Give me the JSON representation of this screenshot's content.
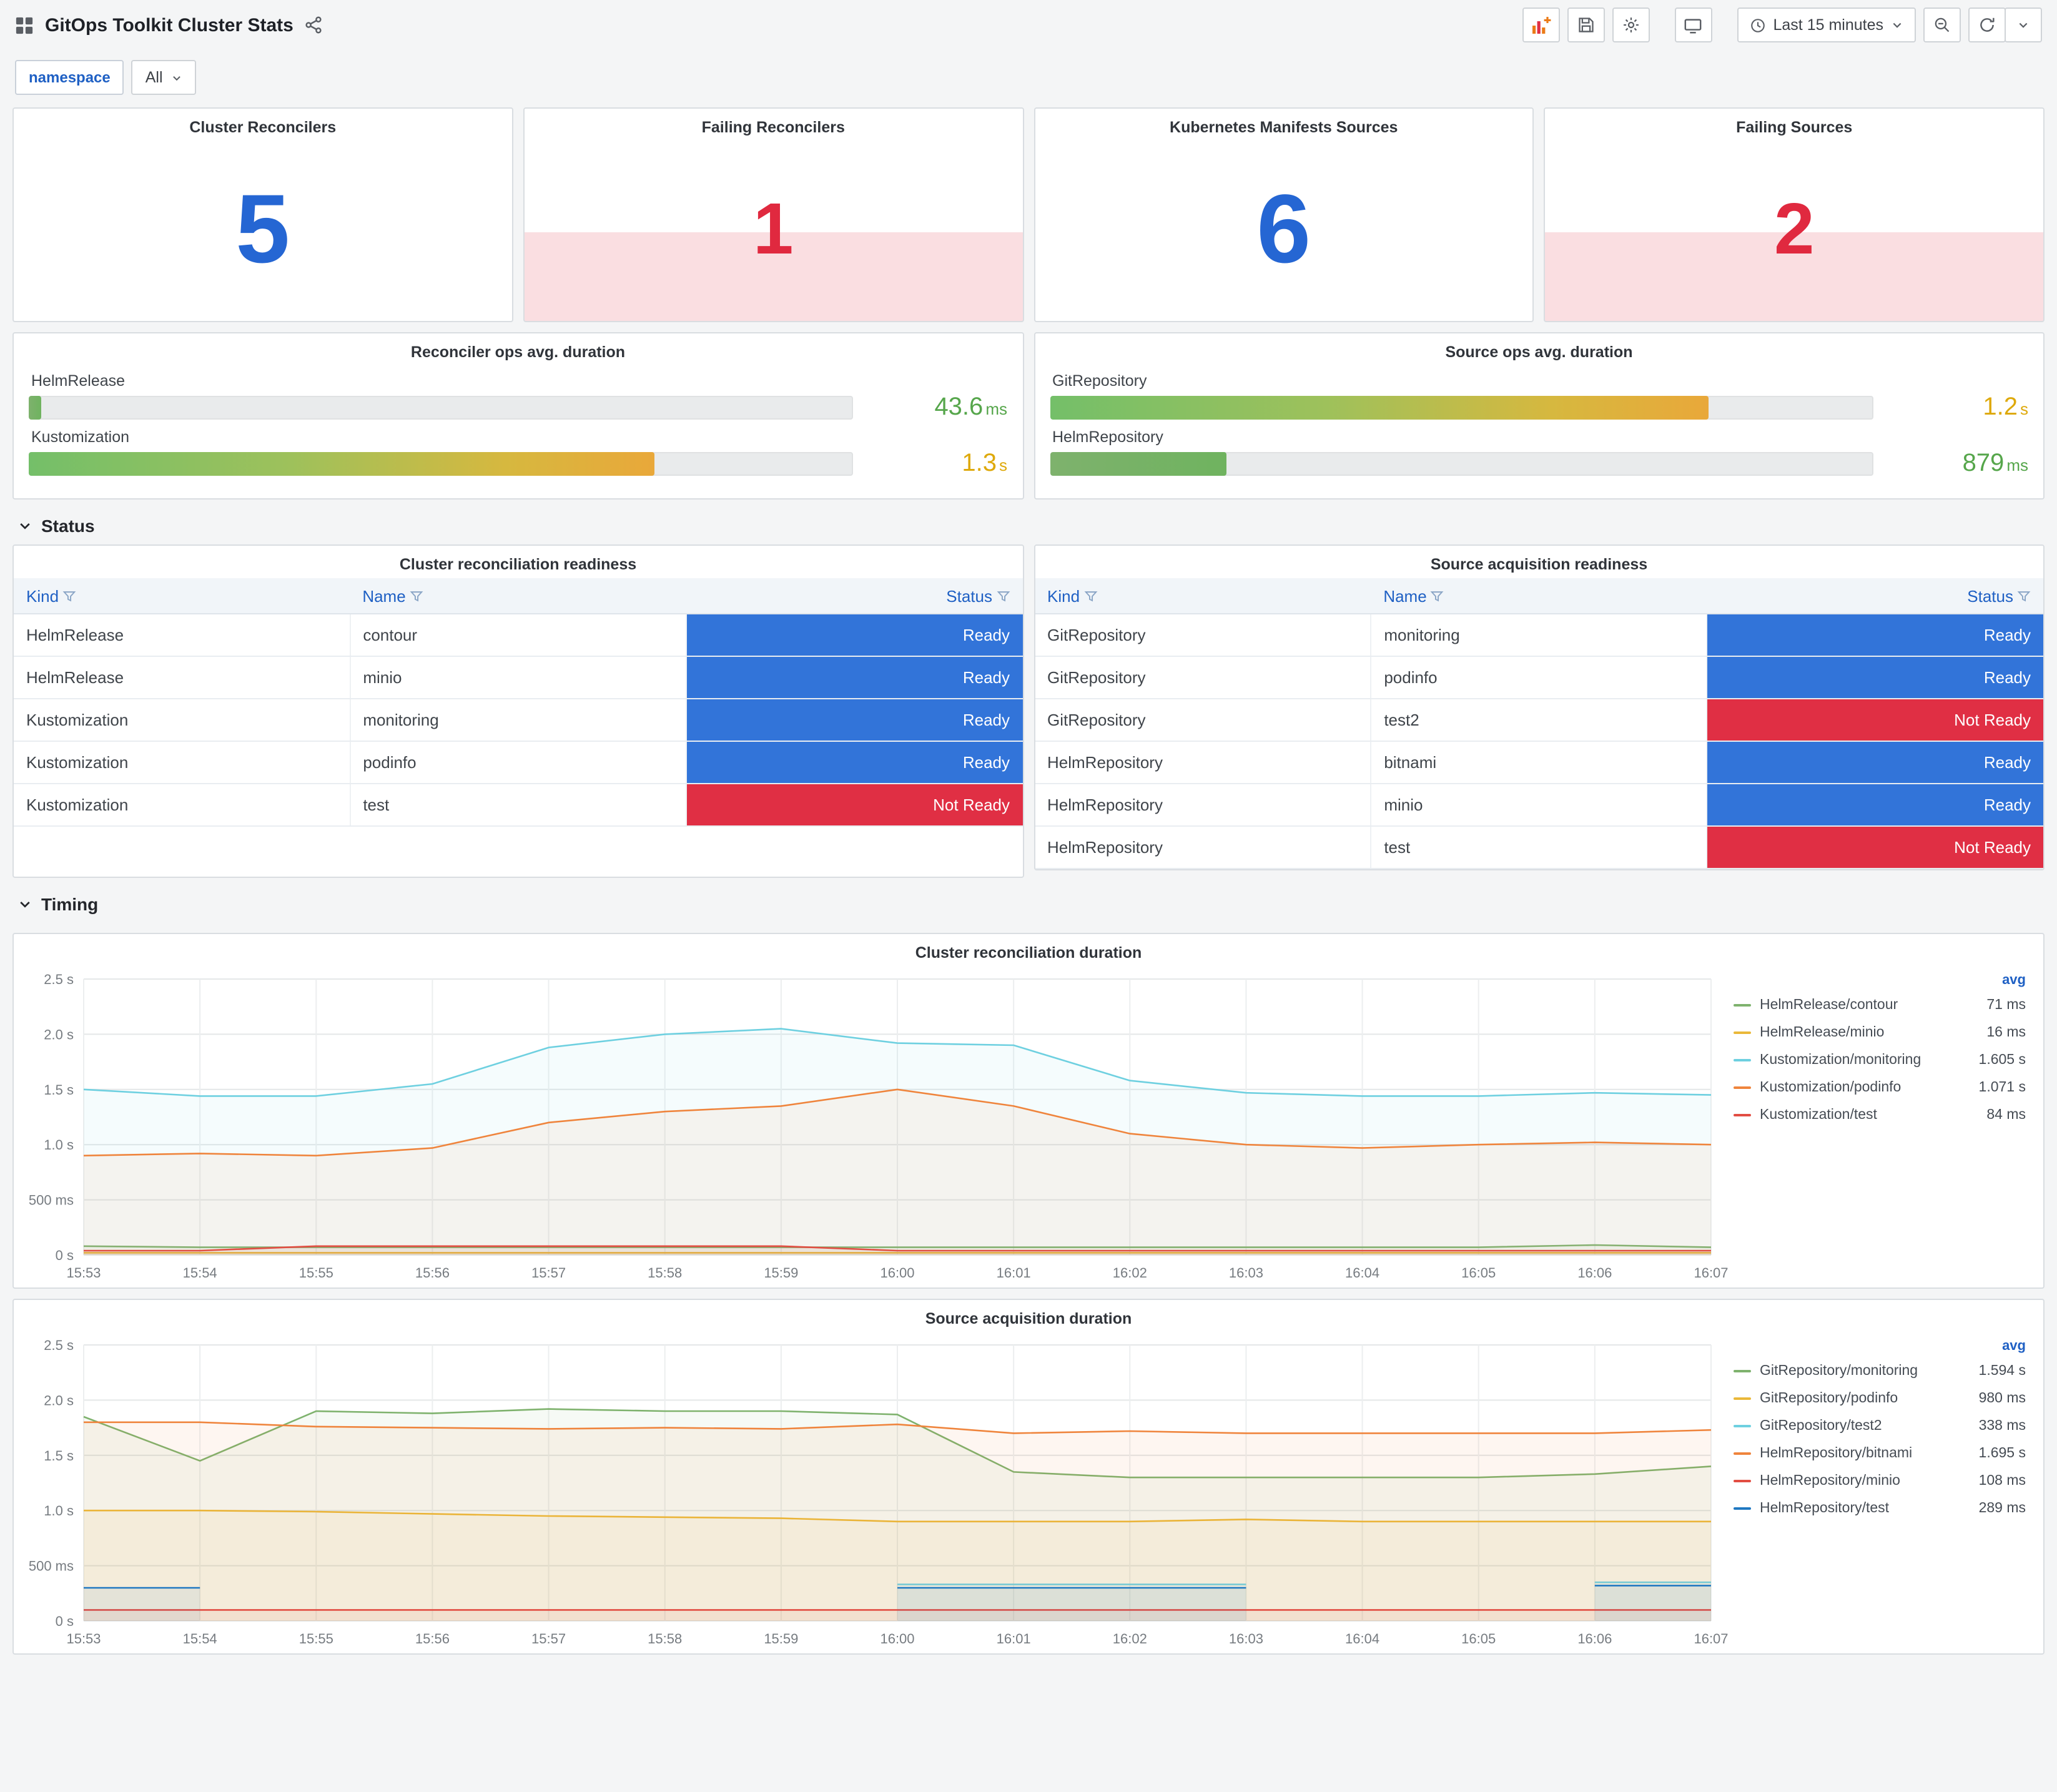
{
  "header": {
    "title": "GitOps Toolkit Cluster Stats",
    "time_range": "Last 15 minutes"
  },
  "variables": {
    "label": "namespace",
    "value": "All"
  },
  "colors": {
    "stat_blue": "#2566d3",
    "alert_red": "#e0293f",
    "ready_bg": "#3274D9",
    "not_ready_bg": "#E02F44",
    "accent_blue": "#1f60c4"
  },
  "stats": [
    {
      "title": "Cluster Reconcilers",
      "value": "5",
      "state": "ok"
    },
    {
      "title": "Failing Reconcilers",
      "value": "1",
      "state": "alert"
    },
    {
      "title": "Kubernetes Manifests Sources",
      "value": "6",
      "state": "ok"
    },
    {
      "title": "Failing Sources",
      "value": "2",
      "state": "alert"
    }
  ],
  "gauges": [
    {
      "title": "Reconciler ops avg. duration",
      "rows": [
        {
          "label": "HelmRelease",
          "value": "43.6",
          "unit": "ms",
          "percent": "1.5%",
          "value_color": "#56A64B"
        },
        {
          "label": "Kustomization",
          "value": "1.3",
          "unit": "s",
          "percent": "76%",
          "value_color": "#DEA90B"
        }
      ]
    },
    {
      "title": "Source ops avg. duration",
      "rows": [
        {
          "label": "GitRepository",
          "value": "1.2",
          "unit": "s",
          "percent": "80%",
          "value_color": "#DEA90B"
        },
        {
          "label": "HelmRepository",
          "value": "879",
          "unit": "ms",
          "percent": "21.5%",
          "value_color": "#56A64B"
        }
      ]
    }
  ],
  "sections": {
    "status": "Status",
    "timing": "Timing"
  },
  "tables": [
    {
      "title": "Cluster reconciliation readiness",
      "columns": [
        "Kind",
        "Name",
        "Status"
      ],
      "rows": [
        {
          "kind": "HelmRelease",
          "name": "contour",
          "status": "Ready"
        },
        {
          "kind": "HelmRelease",
          "name": "minio",
          "status": "Ready"
        },
        {
          "kind": "Kustomization",
          "name": "monitoring",
          "status": "Ready"
        },
        {
          "kind": "Kustomization",
          "name": "podinfo",
          "status": "Ready"
        },
        {
          "kind": "Kustomization",
          "name": "test",
          "status": "Not Ready"
        }
      ]
    },
    {
      "title": "Source acquisition readiness",
      "columns": [
        "Kind",
        "Name",
        "Status"
      ],
      "rows": [
        {
          "kind": "GitRepository",
          "name": "monitoring",
          "status": "Ready"
        },
        {
          "kind": "GitRepository",
          "name": "podinfo",
          "status": "Ready"
        },
        {
          "kind": "GitRepository",
          "name": "test2",
          "status": "Not Ready"
        },
        {
          "kind": "HelmRepository",
          "name": "bitnami",
          "status": "Ready"
        },
        {
          "kind": "HelmRepository",
          "name": "minio",
          "status": "Ready"
        },
        {
          "kind": "HelmRepository",
          "name": "test",
          "status": "Not Ready"
        }
      ]
    }
  ],
  "chart_data": [
    {
      "type": "line",
      "title": "Cluster reconciliation duration",
      "x": [
        "15:53",
        "15:54",
        "15:55",
        "15:56",
        "15:57",
        "15:58",
        "15:59",
        "16:00",
        "16:01",
        "16:02",
        "16:03",
        "16:04",
        "16:05",
        "16:06",
        "16:07"
      ],
      "ylim": [
        0,
        2.5
      ],
      "yticks": [
        0,
        0.5,
        1.0,
        1.5,
        2.0,
        2.5
      ],
      "ytick_labels": [
        "0 s",
        "500 ms",
        "1.0 s",
        "1.5 s",
        "2.0 s",
        "2.5 s"
      ],
      "grid": true,
      "legend_position": "right",
      "legend_header": "avg",
      "series": [
        {
          "name": "HelmRelease/contour",
          "color": "#7EB26D",
          "avg": "71 ms",
          "values": [
            0.08,
            0.07,
            0.07,
            0.07,
            0.07,
            0.07,
            0.07,
            0.07,
            0.07,
            0.07,
            0.07,
            0.07,
            0.07,
            0.09,
            0.07
          ]
        },
        {
          "name": "HelmRelease/minio",
          "color": "#EAB839",
          "avg": "16 ms",
          "values": [
            0.02,
            0.02,
            0.02,
            0.02,
            0.02,
            0.02,
            0.02,
            0.02,
            0.02,
            0.02,
            0.02,
            0.02,
            0.02,
            0.02,
            0.02
          ]
        },
        {
          "name": "Kustomization/monitoring",
          "color": "#6ED0E0",
          "avg": "1.605 s",
          "values": [
            1.5,
            1.44,
            1.44,
            1.55,
            1.88,
            2.0,
            2.05,
            1.92,
            1.9,
            1.58,
            1.47,
            1.44,
            1.44,
            1.47,
            1.45
          ]
        },
        {
          "name": "Kustomization/podinfo",
          "color": "#EF843C",
          "avg": "1.071 s",
          "values": [
            0.9,
            0.92,
            0.9,
            0.97,
            1.2,
            1.3,
            1.35,
            1.5,
            1.35,
            1.1,
            1.0,
            0.97,
            1.0,
            1.02,
            1.0
          ]
        },
        {
          "name": "Kustomization/test",
          "color": "#E24D42",
          "avg": "84 ms",
          "values": [
            0.04,
            0.04,
            0.08,
            0.08,
            0.08,
            0.08,
            0.08,
            0.04,
            0.04,
            0.04,
            0.04,
            0.04,
            0.04,
            0.04,
            0.04
          ]
        }
      ]
    },
    {
      "type": "line",
      "title": "Source acquisition duration",
      "x": [
        "15:53",
        "15:54",
        "15:55",
        "15:56",
        "15:57",
        "15:58",
        "15:59",
        "16:00",
        "16:01",
        "16:02",
        "16:03",
        "16:04",
        "16:05",
        "16:06",
        "16:07"
      ],
      "ylim": [
        0,
        2.5
      ],
      "yticks": [
        0,
        0.5,
        1.0,
        1.5,
        2.0,
        2.5
      ],
      "ytick_labels": [
        "0 s",
        "500 ms",
        "1.0 s",
        "1.5 s",
        "2.0 s",
        "2.5 s"
      ],
      "grid": true,
      "legend_position": "right",
      "legend_header": "avg",
      "series": [
        {
          "name": "GitRepository/monitoring",
          "color": "#7EB26D",
          "avg": "1.594 s",
          "values": [
            1.85,
            1.45,
            1.9,
            1.88,
            1.92,
            1.9,
            1.9,
            1.87,
            1.35,
            1.3,
            1.3,
            1.3,
            1.3,
            1.33,
            1.4
          ]
        },
        {
          "name": "GitRepository/podinfo",
          "color": "#EAB839",
          "avg": "980 ms",
          "values": [
            1.0,
            1.0,
            0.99,
            0.97,
            0.95,
            0.94,
            0.93,
            0.9,
            0.9,
            0.9,
            0.92,
            0.9,
            0.9,
            0.9,
            0.9
          ]
        },
        {
          "name": "GitRepository/test2",
          "color": "#6ED0E0",
          "avg": "338 ms",
          "values": [
            null,
            null,
            null,
            null,
            null,
            null,
            null,
            0.33,
            0.33,
            0.33,
            0.33,
            null,
            null,
            0.35,
            0.35
          ]
        },
        {
          "name": "HelmRepository/bitnami",
          "color": "#EF843C",
          "avg": "1.695 s",
          "values": [
            1.8,
            1.8,
            1.76,
            1.75,
            1.74,
            1.75,
            1.74,
            1.78,
            1.7,
            1.72,
            1.7,
            1.7,
            1.7,
            1.7,
            1.73
          ]
        },
        {
          "name": "HelmRepository/minio",
          "color": "#E24D42",
          "avg": "108 ms",
          "values": [
            0.1,
            0.1,
            0.1,
            0.1,
            0.1,
            0.1,
            0.1,
            0.1,
            0.1,
            0.1,
            0.1,
            0.1,
            0.1,
            0.1,
            0.1
          ]
        },
        {
          "name": "HelmRepository/test",
          "color": "#1F78C1",
          "avg": "289 ms",
          "values": [
            0.3,
            0.3,
            null,
            null,
            null,
            null,
            null,
            0.3,
            0.3,
            0.3,
            0.3,
            null,
            null,
            0.32,
            0.32
          ]
        }
      ]
    }
  ]
}
